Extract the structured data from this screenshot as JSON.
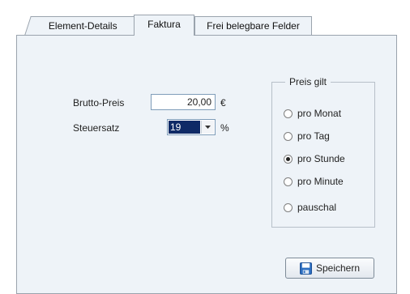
{
  "tabs": [
    {
      "label": "Element-Details"
    },
    {
      "label": "Faktura"
    },
    {
      "label": "Frei belegbare Felder"
    }
  ],
  "form": {
    "gross_price_label": "Brutto-Preis",
    "gross_price_value": "20,00",
    "currency_symbol": "€",
    "tax_rate_label": "Steuersatz",
    "tax_rate_value": "19",
    "percent_symbol": "%"
  },
  "price_validity": {
    "title": "Preis gilt",
    "options": [
      {
        "label": "pro Monat",
        "selected": false
      },
      {
        "label": "pro Tag",
        "selected": false
      },
      {
        "label": "pro Stunde",
        "selected": true
      },
      {
        "label": "pro Minute",
        "selected": false
      },
      {
        "label": "pauschal",
        "selected": false
      }
    ]
  },
  "save_button": {
    "label": "Speichern",
    "icon": "floppy-disk-icon"
  },
  "colors": {
    "panel_bg": "#eef3f8",
    "selected_value_bg": "#0f2a66",
    "save_icon": "#2d6fc1"
  }
}
